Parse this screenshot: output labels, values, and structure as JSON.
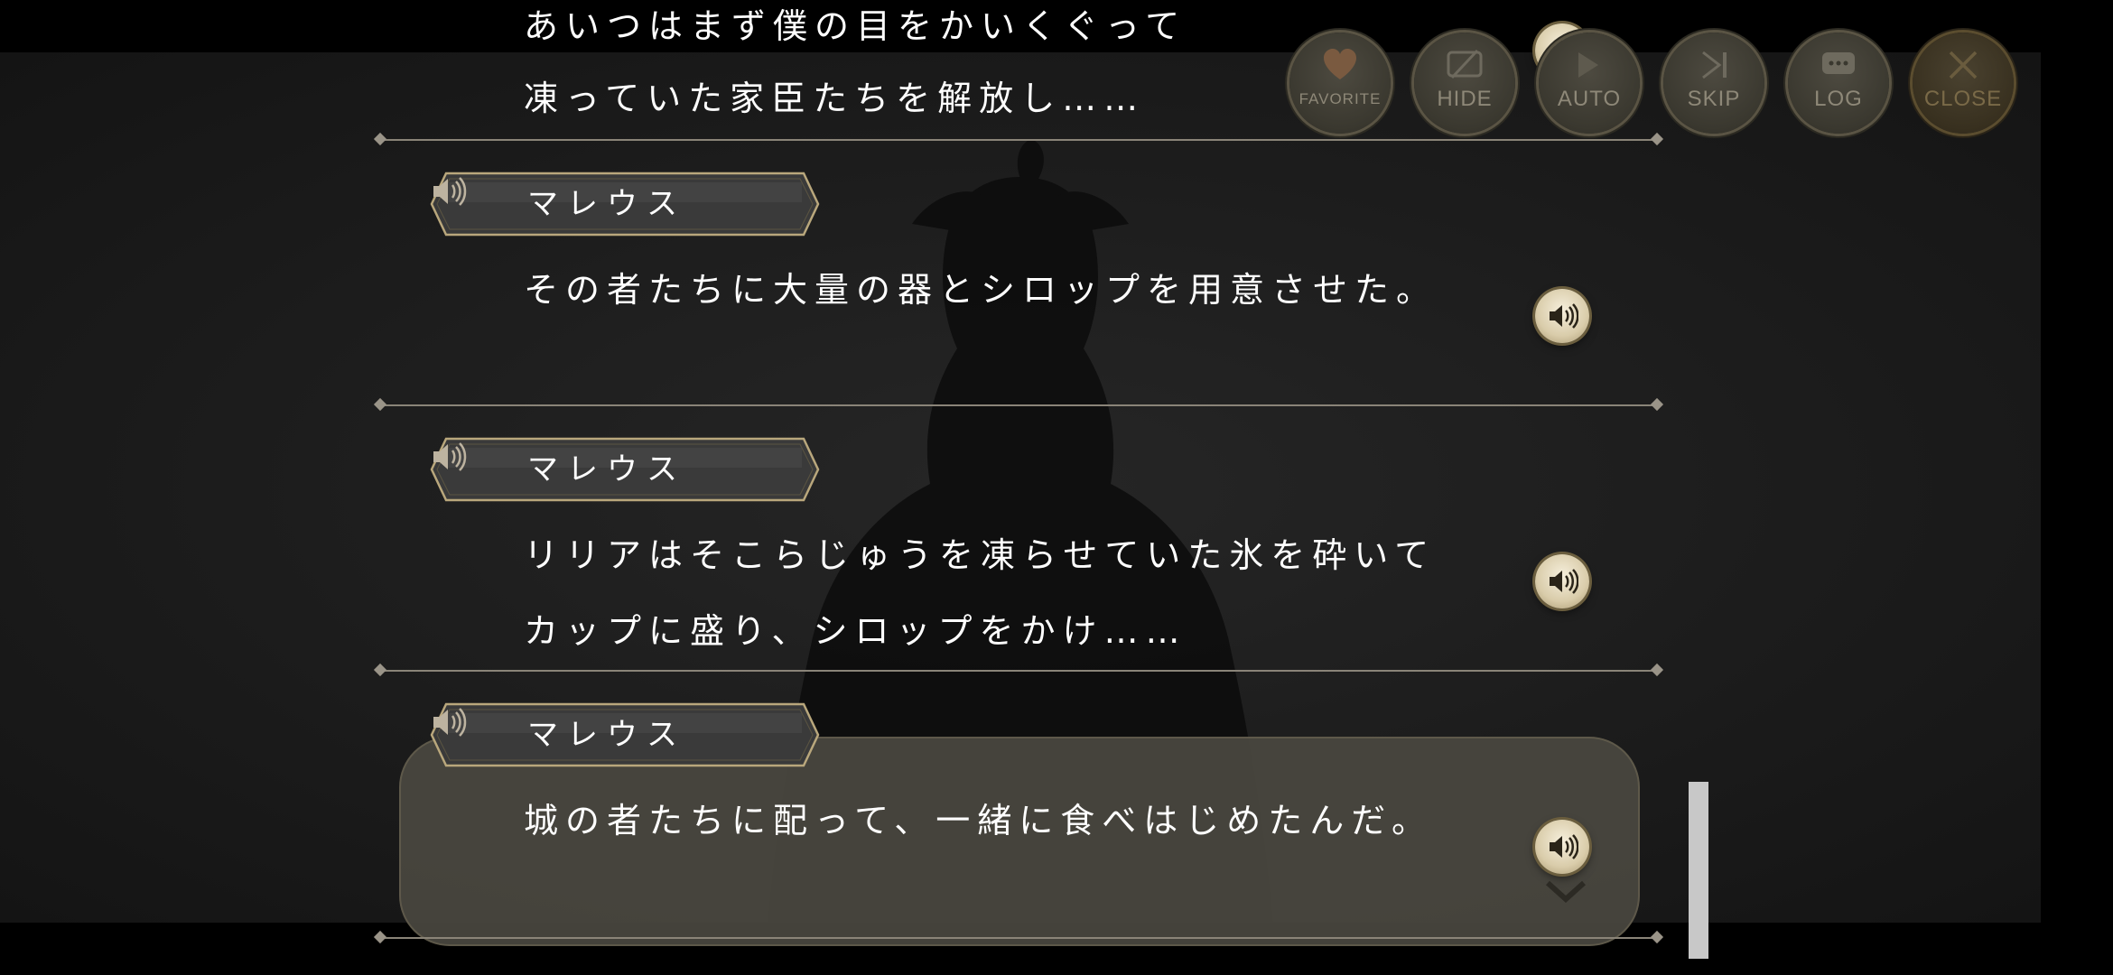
{
  "toolbar": {
    "favorite_label": "FAVORITE",
    "hide_label": "HIDE",
    "auto_label": "AUTO",
    "skip_label": "SKIP",
    "log_label": "LOG",
    "close_label": "CLOSE"
  },
  "log": {
    "partial_entry": {
      "lines": [
        "あいつはまず僕の目をかいくぐって",
        "凍っていた家臣たちを解放し……"
      ]
    },
    "entries": [
      {
        "speaker": "マレウス",
        "lines": [
          "その者たちに大量の器とシロップを用意させた。"
        ]
      },
      {
        "speaker": "マレウス",
        "lines": [
          "リリアはそこらじゅうを凍らせていた氷を砕いて",
          "カップに盛り、シロップをかけ……"
        ]
      },
      {
        "speaker": "マレウス",
        "lines": [
          "城の者たちに配って、一緒に食べはじめたんだ。"
        ]
      }
    ]
  },
  "icons": {
    "voice": "speaker-icon",
    "favorite": "heart-icon",
    "hide": "hide-icon",
    "auto": "auto-icon",
    "skip": "skip-icon",
    "log": "chat-bubble-icon",
    "close": "close-icon",
    "next": "chevron-down-icon"
  },
  "colors": {
    "accent_gold": "#c9b98f",
    "panel": "#4a4840"
  }
}
